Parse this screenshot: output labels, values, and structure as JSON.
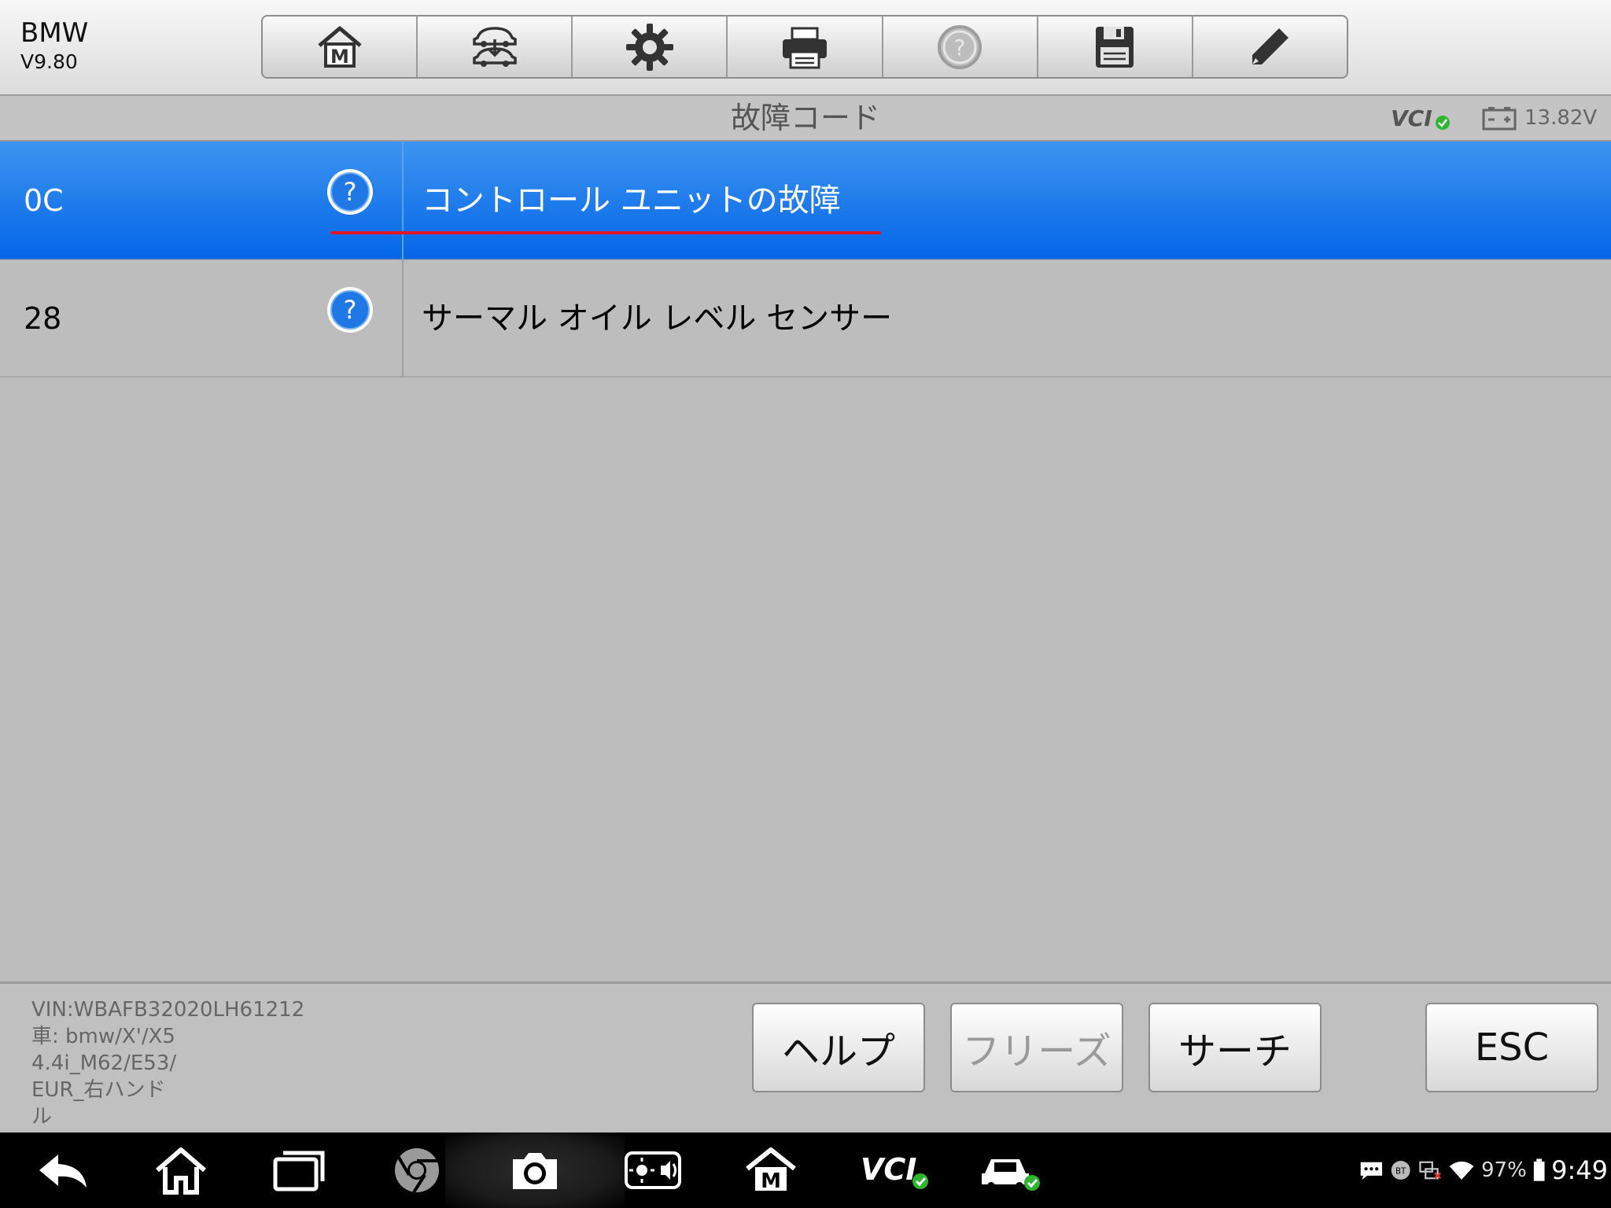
{
  "header": {
    "brand": "BMW",
    "version": "V9.80",
    "toolbar": [
      {
        "name": "home-m-icon"
      },
      {
        "name": "vehicle-swap-icon"
      },
      {
        "name": "gear-icon"
      },
      {
        "name": "printer-icon"
      },
      {
        "name": "help-circle-icon"
      },
      {
        "name": "floppy-save-icon"
      },
      {
        "name": "pencil-icon"
      }
    ]
  },
  "titlebar": {
    "title": "故障コード",
    "vci_label": "VCI",
    "voltage": "13.82V"
  },
  "dtc_list": [
    {
      "code": "0C",
      "description": "コントロール ユニットの故障",
      "selected": true
    },
    {
      "code": "28",
      "description": "サーマル オイル レベル センサー",
      "selected": false
    }
  ],
  "vehicle": {
    "vin": "VIN:WBAFB32020LH61212",
    "car_line1": "車: bmw/X'/X5",
    "car_line2": "4.4i_M62/E53/",
    "car_line3": "EUR_右ハンド",
    "car_line4": "ル"
  },
  "actions": {
    "help": "ヘルプ",
    "freeze": "フリーズ",
    "search": "サーチ",
    "esc": "ESC"
  },
  "system_tray": {
    "bt_label": "BT",
    "battery_pct": "97%",
    "clock": "9:49"
  },
  "colors": {
    "selected_row": "#0566e8",
    "underline": "#e3132a",
    "vci_ok": "#2fb52f"
  }
}
